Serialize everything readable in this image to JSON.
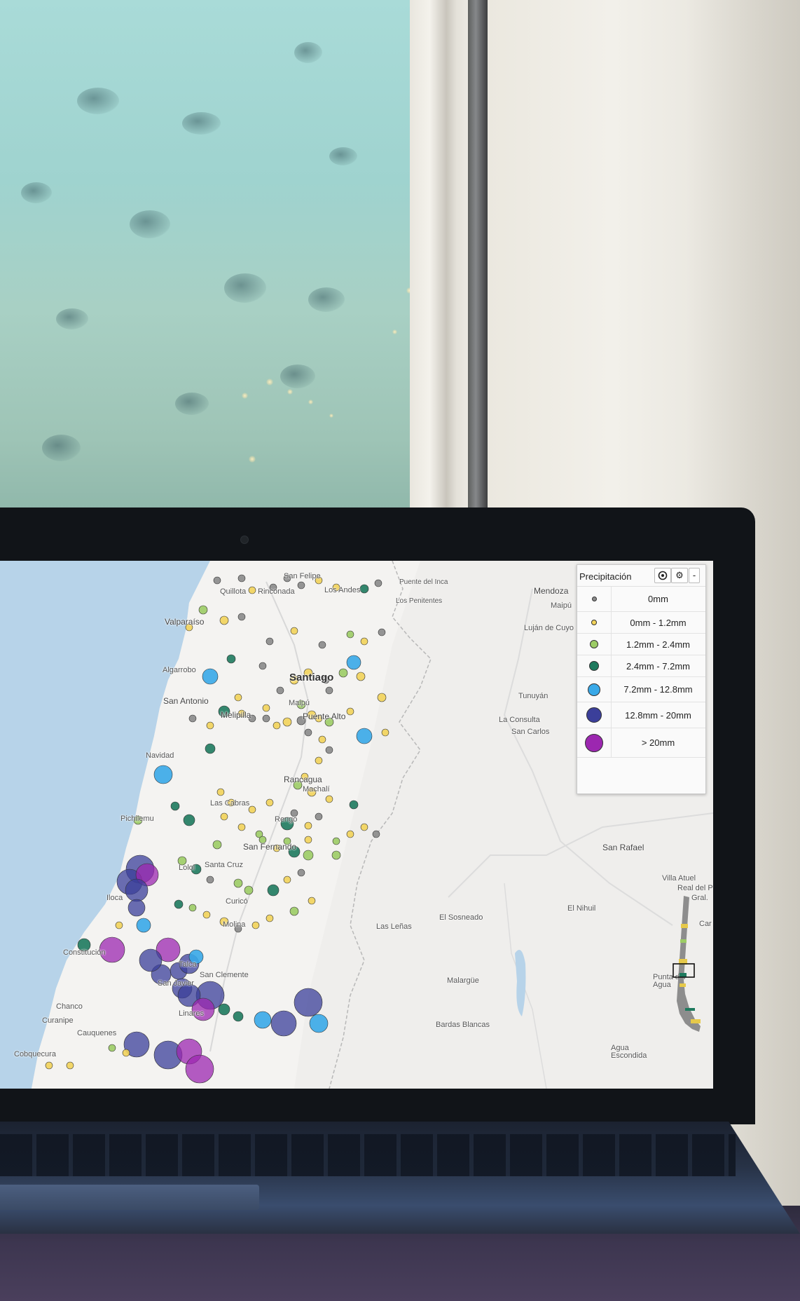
{
  "map": {
    "labels": [
      "San Felipe",
      "Quillota",
      "Rinconada",
      "Los Andes",
      "Puente del Inca",
      "Los Penitentes",
      "Mendoza",
      "Maipú",
      "Luján de Cuyo",
      "Valparaíso",
      "Algarrobo",
      "Santiago",
      "San Antonio",
      "Maipú",
      "Melipilla",
      "Puente Alto",
      "Tunuyán",
      "La Consulta",
      "San Carlos",
      "Navidad",
      "Rancagua",
      "Machalí",
      "Las Cabras",
      "Rengo",
      "Pichilemu",
      "San Fernando",
      "Lolol",
      "Santa Cruz",
      "San Rafael",
      "Villa Atuel",
      "Real del Padre",
      "Gral.",
      "Iloca",
      "Curicó",
      "Molina",
      "El Sosneado",
      "El Nihuil",
      "Las Leñas",
      "Constitución",
      "Talca",
      "San Clemente",
      "San Javier",
      "Chanco",
      "Cauquenes",
      "Curanipe",
      "Linares",
      "Cobquecura",
      "Malargüe",
      "Bardas Blancas",
      "Punta del Agua",
      "Agua Escondida",
      "Car"
    ]
  },
  "legend": {
    "title": "Precipitación",
    "target_icon": "target-icon",
    "gear_icon": "gear-icon",
    "collapse_label": "-",
    "rows": [
      {
        "range": "0mm",
        "color": "#8a8a8a"
      },
      {
        "range": "0mm - 1.2mm",
        "color": "#f2d35a"
      },
      {
        "range": "1.2mm - 2.4mm",
        "color": "#9ccc65"
      },
      {
        "range": "2.4mm - 7.2mm",
        "color": "#1e7a5e"
      },
      {
        "range": "7.2mm - 12.8mm",
        "color": "#39a9e8"
      },
      {
        "range": "12.8mm - 20mm",
        "color": "#3b3f9a"
      },
      {
        "range": "> 20mm",
        "color": "#9c27b0"
      }
    ]
  }
}
